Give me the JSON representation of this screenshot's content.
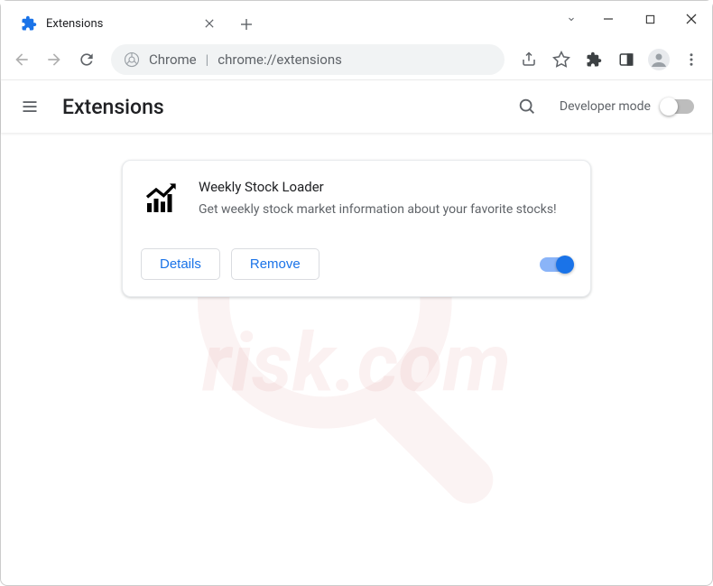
{
  "window": {
    "tab_title": "Extensions"
  },
  "omnibox": {
    "prefix": "Chrome",
    "url": "chrome://extensions"
  },
  "header": {
    "title": "Extensions",
    "dev_mode_label": "Developer mode"
  },
  "extension": {
    "name": "Weekly Stock Loader",
    "description": "Get weekly stock market information about your favorite stocks!",
    "details_label": "Details",
    "remove_label": "Remove",
    "enabled": true
  }
}
